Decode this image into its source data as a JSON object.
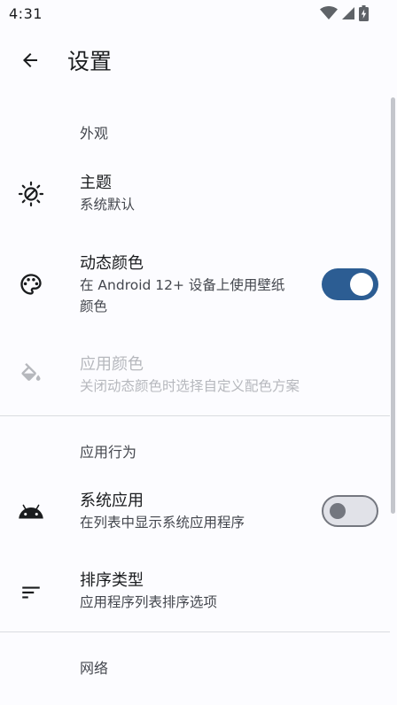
{
  "status_bar": {
    "time": "4:31",
    "icons": [
      "wifi-icon",
      "signal-icon",
      "battery-charging-icon"
    ]
  },
  "app_bar": {
    "back_icon": "arrow-back-icon",
    "title": "设置"
  },
  "sections": {
    "appearance": {
      "header": "外观",
      "theme": {
        "icon": "brightness-icon",
        "title": "主题",
        "summary": "系统默认"
      },
      "dynamic_color": {
        "icon": "palette-icon",
        "title": "动态颜色",
        "summary_line1": "在 Android 12+ 设备上使用壁纸",
        "summary_line2": "颜色",
        "enabled": true
      },
      "app_color": {
        "icon": "format-color-fill-icon",
        "title": "应用颜色",
        "summary": "关闭动态颜色时选择自定义配色方案",
        "disabled": true
      }
    },
    "app_behavior": {
      "header": "应用行为",
      "system_apps": {
        "icon": "android-icon",
        "title": "系统应用",
        "summary": "在列表中显示系统应用程序",
        "enabled": false
      },
      "sort_type": {
        "icon": "sort-icon",
        "title": "排序类型",
        "summary": "应用程序列表排序选项"
      }
    },
    "network": {
      "header": "网络"
    }
  },
  "colors": {
    "accent": "#2c5d93",
    "background": "#fcfcff",
    "switch_off_track": "#e1e2e8",
    "switch_off_outline": "#74777f"
  }
}
